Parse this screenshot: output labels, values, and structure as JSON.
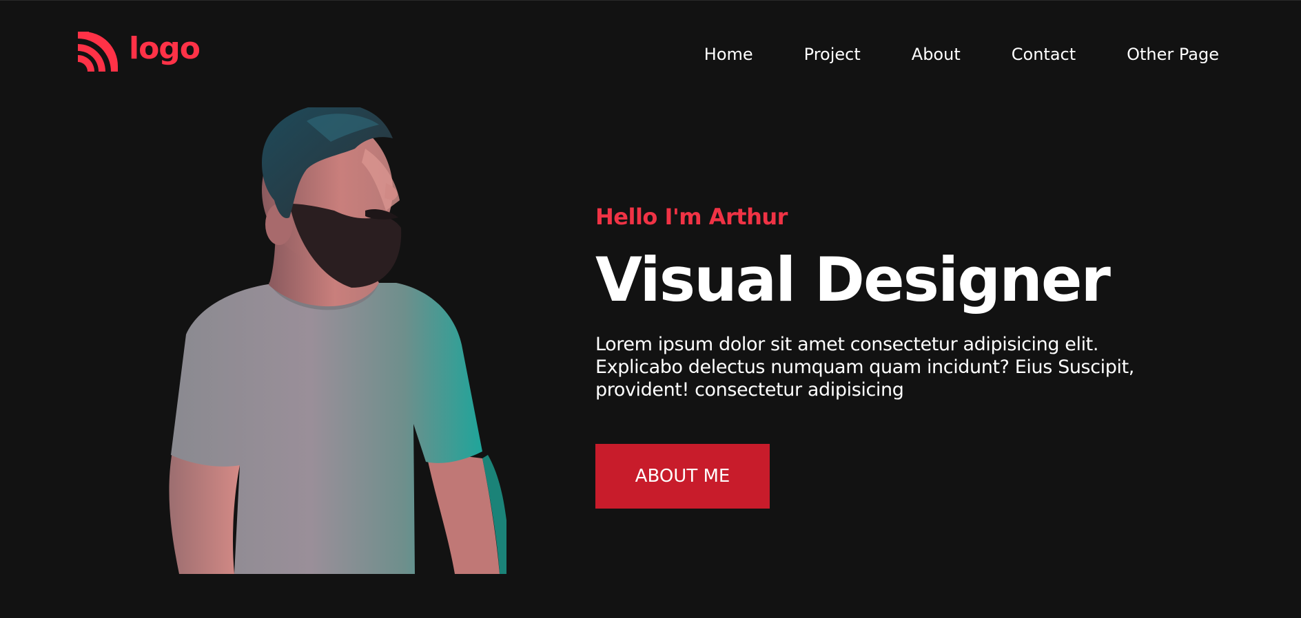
{
  "brand": {
    "logo_text": "logo",
    "icon": "rss-arcs-icon",
    "color": "#ff3247"
  },
  "nav": {
    "items": [
      {
        "label": "Home"
      },
      {
        "label": "Project"
      },
      {
        "label": "About"
      },
      {
        "label": "Contact"
      },
      {
        "label": "Other Page"
      }
    ]
  },
  "hero": {
    "greeting": "Hello I'm Arthur",
    "title": "Visual Designer",
    "description": "Lorem ipsum dolor sit amet consectetur adipisicing elit. Explicabo delectus numquam quam incidunt? Eius Suscipit, provident! consectetur adipisicing",
    "cta_label": "ABOUT ME"
  },
  "colors": {
    "background": "#121212",
    "accent": "#f03345",
    "button": "#c81c2b",
    "text": "#ffffff"
  }
}
